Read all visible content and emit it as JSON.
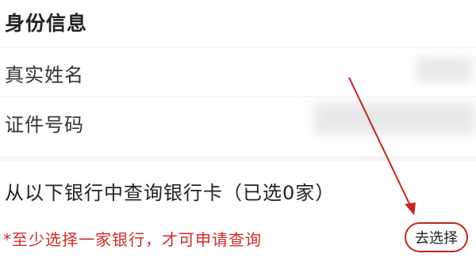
{
  "identity": {
    "section_title": "身份信息",
    "name_label": "真实姓名",
    "id_label": "证件号码"
  },
  "banks": {
    "title": "从以下银行中查询银行卡（已选0家）",
    "warning": "*至少选择一家银行，才可申请查询",
    "choose_button_label": "去选择"
  },
  "colors": {
    "accent": "#c2261f",
    "warning": "#d42a2a"
  }
}
